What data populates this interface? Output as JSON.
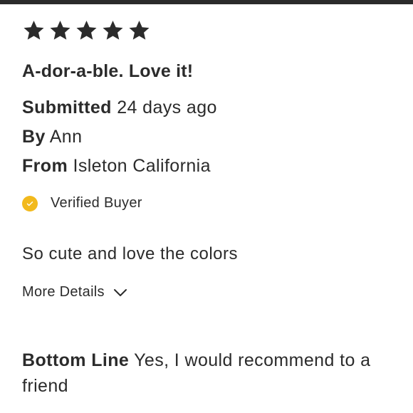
{
  "review": {
    "rating": 5,
    "rating_max": 5,
    "headline": "A-dor-a-ble. Love it!",
    "submitted_label": "Submitted",
    "submitted_value": "24 days ago",
    "by_label": "By",
    "by_value": "Ann",
    "from_label": "From",
    "from_value": "Isleton California",
    "verified_text": "Verified Buyer",
    "body": "So cute and love the colors",
    "more_details": "More Details",
    "bottom_line_label": "Bottom Line",
    "bottom_line_value": "Yes, I would recommend to a friend"
  },
  "colors": {
    "text": "#2b2b2b",
    "verified_badge": "#f2b91c",
    "top_bar": "#2b2b2b"
  },
  "icons": {
    "star": "star-icon",
    "verified": "check-circle-icon",
    "expand": "chevron-down-icon"
  }
}
